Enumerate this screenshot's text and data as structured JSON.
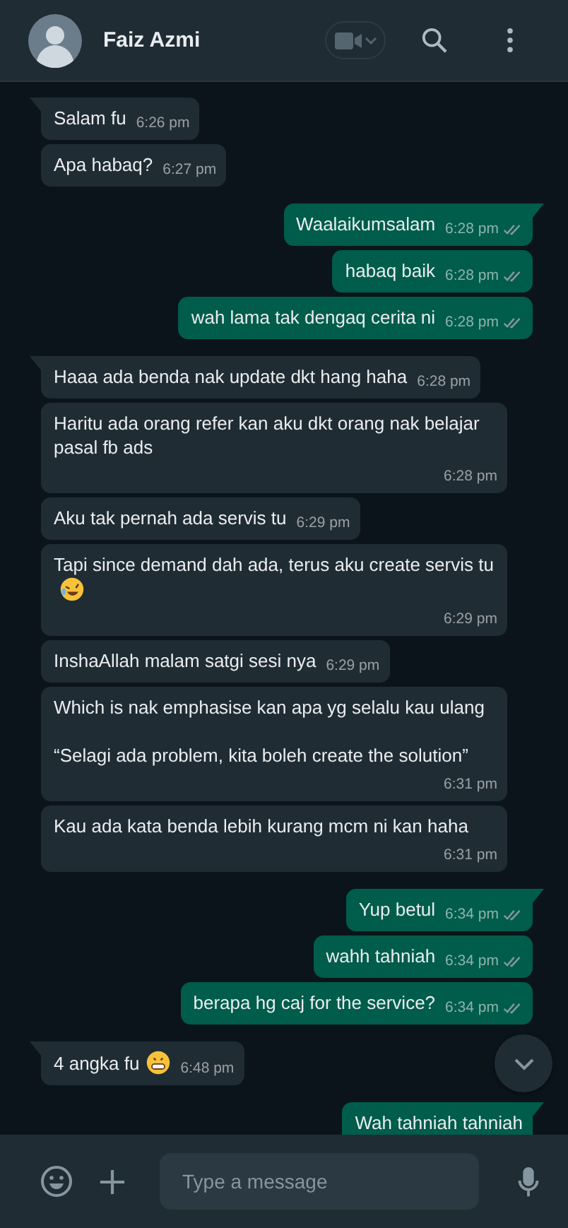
{
  "header": {
    "name": "Faiz Azmi"
  },
  "messages": [
    {
      "kind": "incoming",
      "tail": true,
      "text": "Salam fu",
      "time": "6:26 pm"
    },
    {
      "kind": "incoming",
      "tail": false,
      "text": "Apa habaq?",
      "time": "6:27 pm"
    },
    {
      "kind": "outgoing",
      "tail": true,
      "text": "Waalaikumsalam",
      "time": "6:28 pm",
      "read": false
    },
    {
      "kind": "outgoing",
      "tail": false,
      "text": "habaq baik",
      "time": "6:28 pm",
      "read": false
    },
    {
      "kind": "outgoing",
      "tail": false,
      "text": "wah lama tak dengaq cerita ni",
      "time": "6:28 pm",
      "read": false
    },
    {
      "kind": "incoming",
      "tail": true,
      "text": "Haaa ada benda nak update dkt hang haha",
      "time": "6:28 pm"
    },
    {
      "kind": "incoming",
      "tail": false,
      "text": "Haritu ada orang refer kan aku dkt orang nak belajar pasal fb ads",
      "time": "6:28 pm"
    },
    {
      "kind": "incoming",
      "tail": false,
      "text": "Aku tak pernah ada servis tu",
      "time": "6:29 pm"
    },
    {
      "kind": "incoming",
      "tail": false,
      "text": "Tapi since demand dah ada, terus aku create servis tu",
      "emoji": {
        "kind": "rofl"
      },
      "time": "6:29 pm"
    },
    {
      "kind": "incoming",
      "tail": false,
      "text": "InshaAllah malam satgi sesi nya",
      "time": "6:29 pm"
    },
    {
      "kind": "incoming",
      "tail": false,
      "text": "Which is nak emphasise kan apa yg selalu kau ulang\n\n“Selagi ada problem, kita boleh create the solution”",
      "time": "6:31 pm"
    },
    {
      "kind": "incoming",
      "tail": false,
      "text": "Kau ada kata benda lebih kurang mcm ni kan haha",
      "time": "6:31 pm"
    },
    {
      "kind": "outgoing",
      "tail": true,
      "text": "Yup betul",
      "time": "6:34 pm",
      "read": false
    },
    {
      "kind": "outgoing",
      "tail": false,
      "text": "wahh tahniah",
      "time": "6:34 pm",
      "read": false
    },
    {
      "kind": "outgoing",
      "tail": false,
      "text": "berapa hg caj for the service?",
      "time": "6:34 pm",
      "read": false
    },
    {
      "kind": "incoming",
      "tail": true,
      "text": "4 angka fu",
      "emoji": {
        "kind": "grin"
      },
      "time": "6:48 pm"
    },
    {
      "kind": "outgoing",
      "tail": true,
      "text": "Wah tahniah tahniah"
    }
  ],
  "composer": {
    "placeholder": "Type a message"
  }
}
